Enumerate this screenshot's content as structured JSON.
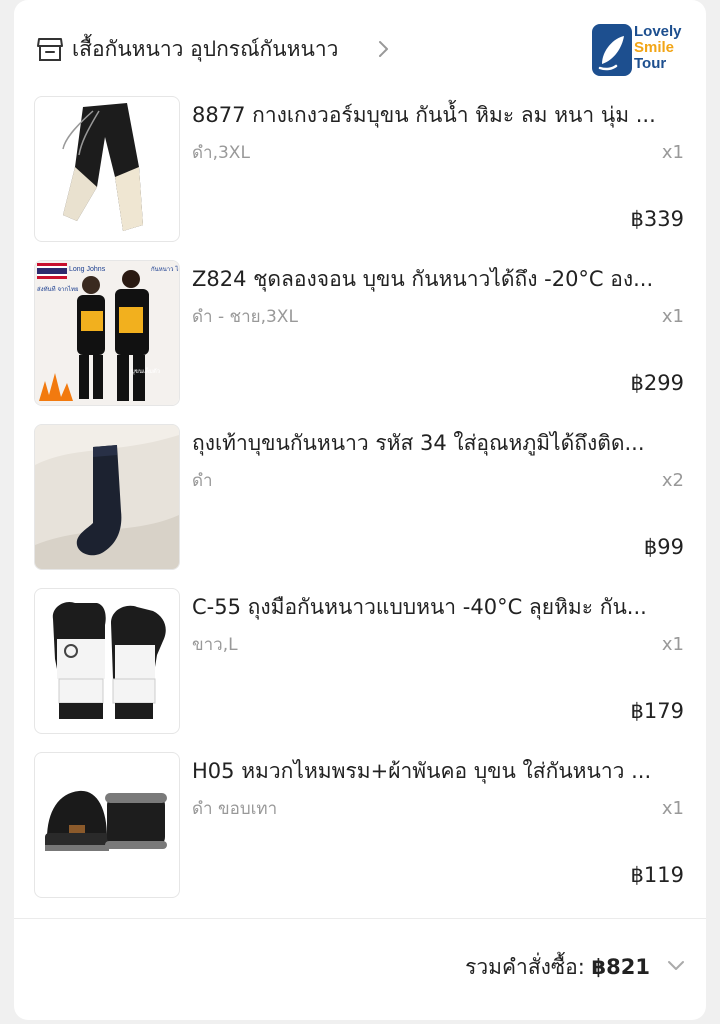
{
  "shop": {
    "category_label": "เสื้อกันหนาว อุปกรณ์กันหนาว",
    "logo_line1": "Lovely",
    "logo_line2": "Smile",
    "logo_line3": "Tour",
    "icons": {
      "store": "store-icon",
      "chevron": "chevron-right-icon",
      "logo_emblem": "leaf-icon"
    }
  },
  "items": [
    {
      "title": "8877 กางเกงวอร์มบุขน กันน้ำ หิมะ ลม หนา นุ่ม ...",
      "variant": "ดำ,3XL",
      "qty": "x1",
      "price": "฿339",
      "image": "fleece-pants"
    },
    {
      "title": "Z824 ชุดลองจอน บุขน กันหนาวได้ถึง -20°C อง...",
      "variant": "ดำ - ชาย,3XL",
      "qty": "x1",
      "price": "฿299",
      "image": "long-johns",
      "image_text": {
        "top_left": "Long Johns",
        "top_right": "กันหนาว ได้ถึง -20°C",
        "left": "ส่งทันที จากไทย",
        "bottom": "บุขนเต็มตัว"
      }
    },
    {
      "title": "ถุงเท้าบุขนกันหนาว รหัส 34 ใส่อุณหภูมิได้ถึงติด...",
      "variant": "ดำ",
      "qty": "x2",
      "price": "฿99",
      "image": "black-sock"
    },
    {
      "title": "C-55 ถุงมือกันหนาวแบบหนา -40°C ลุยหิมะ กัน...",
      "variant": "ขาว,L",
      "qty": "x1",
      "price": "฿179",
      "image": "ski-gloves"
    },
    {
      "title": "H05 หมวกไหมพรม+ผ้าพันคอ บุขน ใส่กันหนาว ...",
      "variant": "ดำ ขอบเทา",
      "qty": "x1",
      "price": "฿119",
      "image": "beanie-scarf"
    }
  ],
  "order_total": {
    "label": "รวมคำสั่งซื้อ:",
    "amount": "฿821",
    "icon": "chevron-down-icon"
  },
  "colors": {
    "text": "#222222",
    "muted": "#999999",
    "background": "#f0f0f0",
    "logo_blue": "#1d4f8f",
    "logo_orange": "#f2a516"
  }
}
